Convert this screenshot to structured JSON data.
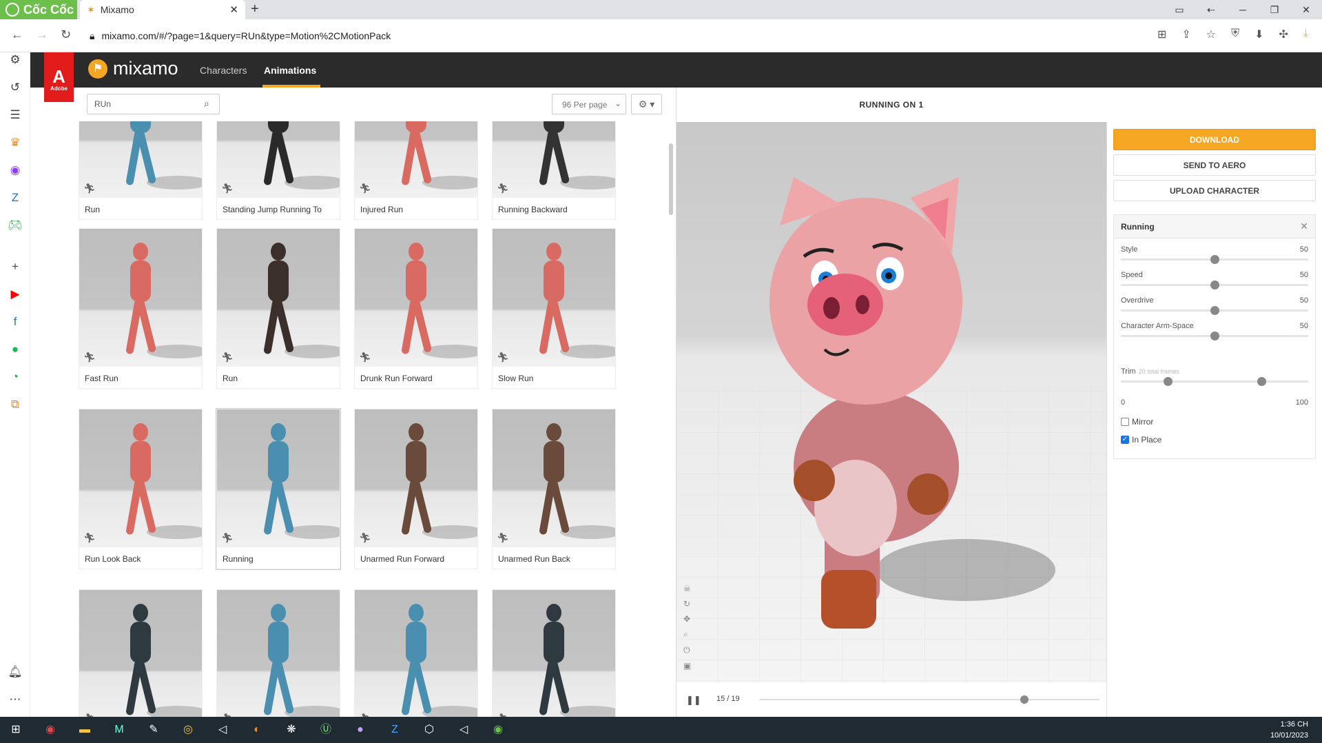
{
  "browser": {
    "brand": "Cốc Cốc",
    "tab_title": "Mixamo",
    "url": "mixamo.com/#/?page=1&query=RUn&type=Motion%2CMotionPack"
  },
  "app": {
    "adobe_label": "Adobe",
    "logo_text": "mixamo",
    "nav": {
      "characters": "Characters",
      "animations": "Animations"
    }
  },
  "toolbar": {
    "search_value": "RUn",
    "per_page": "96 Per page"
  },
  "grid": {
    "cards": [
      {
        "label": "Run",
        "color": "#4a8fb0"
      },
      {
        "label": "Standing Jump Running To",
        "color": "#2a2a2a"
      },
      {
        "label": "Injured Run",
        "color": "#d96a62"
      },
      {
        "label": "Running Backward",
        "color": "#333333"
      },
      {
        "label": "Fast Run",
        "color": "#d96a62"
      },
      {
        "label": "Run",
        "color": "#3a2f2a"
      },
      {
        "label": "Drunk Run Forward",
        "color": "#d96a62"
      },
      {
        "label": "Slow Run",
        "color": "#d96a62"
      },
      {
        "label": "Run Look Back",
        "color": "#d96a62"
      },
      {
        "label": "Running",
        "color": "#4a8fb0"
      },
      {
        "label": "Unarmed Run Forward",
        "color": "#6a4a3a"
      },
      {
        "label": "Unarmed Run Back",
        "color": "#6a4a3a"
      },
      {
        "label": "",
        "color": "#2f3a40"
      },
      {
        "label": "",
        "color": "#4a8fb0"
      },
      {
        "label": "",
        "color": "#4a8fb0"
      },
      {
        "label": "",
        "color": "#2f3a40"
      }
    ]
  },
  "viewer": {
    "title": "RUNNING ON 1",
    "frame_counter": "15 / 19",
    "progress": 0.78
  },
  "panel": {
    "download": "DOWNLOAD",
    "send_to_aero": "SEND TO AERO",
    "upload_character": "UPLOAD CHARACTER",
    "section_title": "Running",
    "params": [
      {
        "label": "Style",
        "value": "50"
      },
      {
        "label": "Speed",
        "value": "50"
      },
      {
        "label": "Overdrive",
        "value": "50"
      },
      {
        "label": "Character Arm-Space",
        "value": "50"
      }
    ],
    "trim": {
      "label": "Trim",
      "hint": "20 total frames",
      "min": "0",
      "max": "100",
      "start": 25,
      "end": 75
    },
    "mirror": {
      "label": "Mirror",
      "checked": false
    },
    "in_place": {
      "label": "In Place",
      "checked": true
    }
  },
  "taskbar": {
    "time": "1:36 CH",
    "date": "10/01/2023"
  },
  "colors": {
    "accent": "#f5a623",
    "header": "#2b2b2b",
    "adobe_red": "#e21b1b"
  }
}
